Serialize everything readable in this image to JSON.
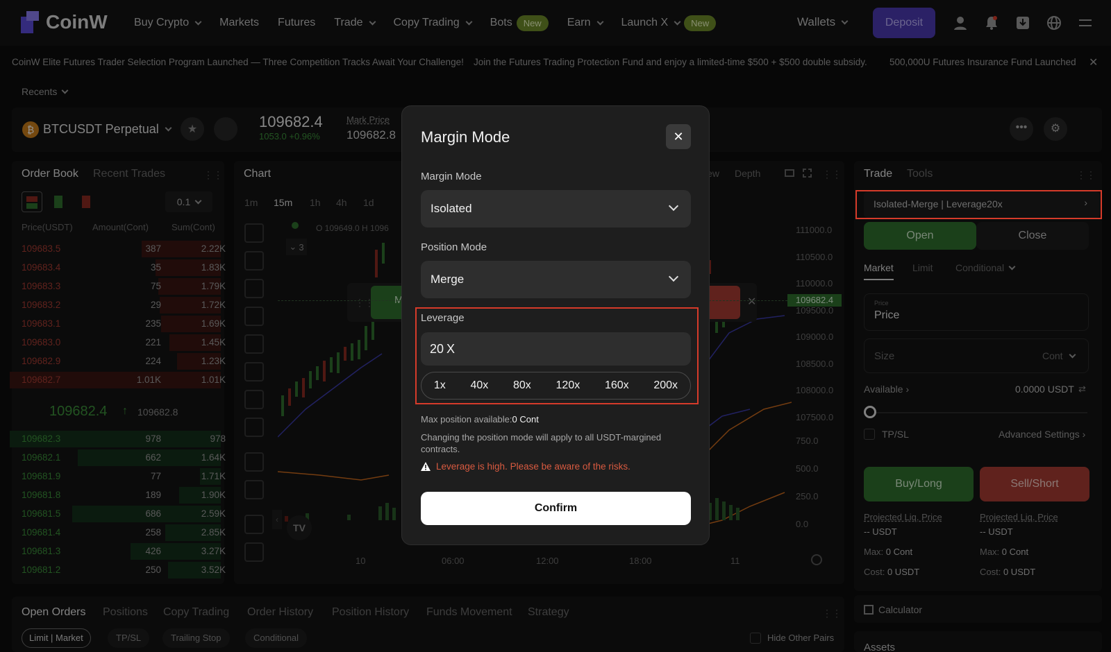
{
  "brand": {
    "name": "CoinW"
  },
  "nav": {
    "items": [
      "Buy Crypto",
      "Markets",
      "Futures",
      "Trade",
      "Copy Trading",
      "Bots",
      "Earn",
      "Launch X"
    ],
    "new_badge": "New",
    "wallets": "Wallets",
    "deposit": "Deposit"
  },
  "ticker": [
    "CoinW Elite Futures Trader Selection Program Launched — Three Competition Tracks Await Your Challenge!",
    "Join the Futures Trading Protection Fund and enjoy a limited-time $500 + $500 double subsidy.",
    "500,000U Futures Insurance Fund Launched"
  ],
  "recents": "Recents",
  "pair": {
    "name": "BTCUSDT Perpetual",
    "price": "109682.4",
    "change": "1053.0 +0.96%",
    "mark_label": "Mark Price",
    "mark_value": "109682.8"
  },
  "orderbook": {
    "tabs": [
      "Order Book",
      "Recent Trades"
    ],
    "precision": "0.1",
    "headers": [
      "Price(USDT)",
      "Amount(Cont)",
      "Sum(Cont)"
    ],
    "asks": [
      [
        "109683.5",
        "387",
        "2.22K"
      ],
      [
        "109683.4",
        "35",
        "1.83K"
      ],
      [
        "109683.3",
        "75",
        "1.79K"
      ],
      [
        "109683.2",
        "29",
        "1.72K"
      ],
      [
        "109683.1",
        "235",
        "1.69K"
      ],
      [
        "109683.0",
        "221",
        "1.45K"
      ],
      [
        "109682.9",
        "224",
        "1.23K"
      ],
      [
        "109682.7",
        "1.01K",
        "1.01K"
      ]
    ],
    "mid_price": "109682.4",
    "mid_mark": "109682.8",
    "bids": [
      [
        "109682.3",
        "978",
        "978"
      ],
      [
        "109682.1",
        "662",
        "1.64K"
      ],
      [
        "109681.9",
        "77",
        "1.71K"
      ],
      [
        "109681.8",
        "189",
        "1.90K"
      ],
      [
        "109681.5",
        "686",
        "2.59K"
      ],
      [
        "109681.4",
        "258",
        "2.85K"
      ],
      [
        "109681.3",
        "426",
        "3.27K"
      ],
      [
        "109681.2",
        "250",
        "3.52K"
      ]
    ]
  },
  "chart": {
    "title": "Chart",
    "intervals": [
      "1m",
      "15m",
      "1h",
      "4h",
      "1d"
    ],
    "view_tabs": [
      "iew",
      "Depth"
    ],
    "ohlc": "O 109649.0  H 1096",
    "indicator_count": "3",
    "price_tag": "109682.4",
    "y_labels": [
      "111000.0",
      "110500.0",
      "110000.0",
      "109500.0",
      "109000.0",
      "108500.0",
      "108000.0",
      "107500.0",
      "750.0",
      "500.0",
      "250.0",
      "0.0"
    ],
    "x_labels": [
      "10",
      "06:00",
      "12:00",
      "18:00",
      "11"
    ],
    "overlay_btns": [
      "M",
      "rt"
    ]
  },
  "trade": {
    "tabs": [
      "Trade",
      "Tools"
    ],
    "mode_pill": "Isolated-Merge | Leverage20x",
    "open": "Open",
    "close": "Close",
    "order_types": [
      "Market",
      "Limit",
      "Conditional"
    ],
    "price_small": "Price",
    "price": "Price",
    "size": "Size",
    "size_unit": "Cont",
    "available": "Available",
    "available_value": "0.0000 USDT",
    "tpsl": "TP/SL",
    "advanced": "Advanced Settings",
    "buy": "Buy/Long",
    "sell": "Sell/Short",
    "liq_label": "Projected Liq. Price",
    "liq_value": "-- USDT",
    "max_label": "Max:",
    "max_value": "0 Cont",
    "cost_label": "Cost:",
    "cost_value": "0 USDT",
    "calculator": "Calculator",
    "assets": "Assets"
  },
  "bottom": {
    "tabs": [
      "Open Orders",
      "Positions",
      "Copy Trading",
      "Order History",
      "Position History",
      "Funds Movement",
      "Strategy"
    ],
    "filters": [
      "Limit | Market",
      "TP/SL",
      "Trailing Stop",
      "Conditional"
    ],
    "hide_pairs": "Hide Other Pairs"
  },
  "modal": {
    "title": "Margin Mode",
    "margin_label": "Margin Mode",
    "margin_value": "Isolated",
    "position_label": "Position Mode",
    "position_value": "Merge",
    "leverage_label": "Leverage",
    "leverage_value": "20",
    "leverage_unit": "X",
    "leverage_options": [
      "1x",
      "40x",
      "80x",
      "120x",
      "160x",
      "200x"
    ],
    "max_position_label": "Max position available:",
    "max_position_value": "0 Cont",
    "note": "Changing the position mode will apply to all USDT-margined contracts.",
    "warning": "Leverage is high. Please be aware of the risks.",
    "confirm": "Confirm"
  }
}
